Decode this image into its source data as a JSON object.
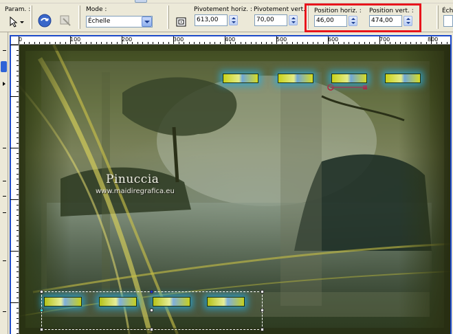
{
  "toolbar": {
    "presets_label": "Param. :",
    "mode_label": "Mode :",
    "mode_value": "Échelle",
    "pivot_h_label": "Pivotement horiz. :",
    "pivot_h_value": "613,00",
    "pivot_v_label": "Pivotement vert. :",
    "pivot_v_value": "70,00",
    "pos_h_label": "Position horiz. :",
    "pos_h_value": "46,00",
    "pos_v_label": "Position vert. :",
    "pos_v_value": "474,00",
    "cut_label": "Éch"
  },
  "ruler": {
    "ticks": [
      "0",
      "100",
      "200",
      "300",
      "400",
      "500",
      "600",
      "700",
      "800"
    ]
  },
  "image": {
    "watermark_name": "Pinuccia",
    "watermark_url": "www.maidiregrafica.eu"
  },
  "colors": {
    "highlight": "#e8141b",
    "canvas_border": "#1c49c9",
    "tile_glow": "#28aadc"
  },
  "icons": [
    "pick-tool-icon",
    "dropdown-arrow-icon",
    "apply-icon",
    "reset-icon",
    "mode-arrow-icon",
    "center-icon",
    "spin-icon"
  ]
}
